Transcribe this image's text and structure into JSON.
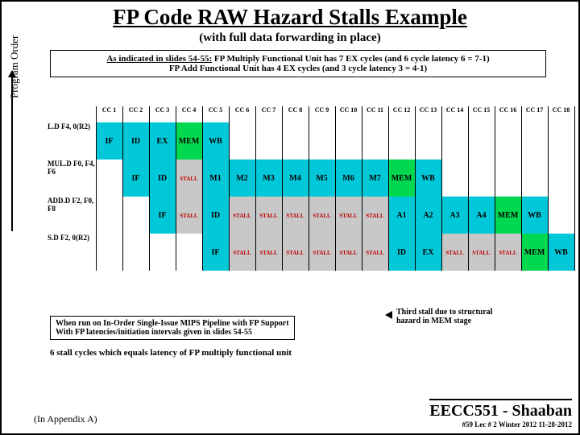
{
  "title": "FP Code RAW Hazard Stalls Example",
  "subtitle": "(with full data forwarding in place)",
  "note": {
    "lead": "As indicated in slides 54-55:",
    "line1": "FP Multiply Functional Unit has 7 EX cycles (and 6 cycle latency 6 = 7-1)",
    "line2": "FP Add Functional Unit has 4 EX cycles (and 3 cycle latency 3 = 4-1)"
  },
  "yaxis_label": "Program Order",
  "cycles": [
    "CC 1",
    "CC 2",
    "CC 3",
    "CC 4",
    "CC 5",
    "CC 6",
    "CC 7",
    "CC 8",
    "CC 9",
    "CC 10",
    "CC 11",
    "CC 12",
    "CC 13",
    "CC 14",
    "CC 15",
    "CC 16",
    "CC 17",
    "CC 18"
  ],
  "rows": [
    {
      "instr": "L.D F4, 0(R2)",
      "cells": [
        "IF",
        "ID",
        "EX",
        "MEM",
        "WB",
        "",
        "",
        "",
        "",
        "",
        "",
        "",
        "",
        "",
        "",
        "",
        "",
        ""
      ],
      "fill": [
        "c",
        "c",
        "c",
        "g",
        "c",
        "",
        "",
        "",
        "",
        "",
        "",
        "",
        "",
        "",
        "",
        "",
        "",
        ""
      ]
    },
    {
      "instr": "MUL.D F0, F4, F6",
      "cells": [
        "",
        "IF",
        "ID",
        "STALL",
        "M1",
        "M2",
        "M3",
        "M4",
        "M5",
        "M6",
        "M7",
        "MEM",
        "WB",
        "",
        "",
        "",
        "",
        ""
      ],
      "fill": [
        "",
        "c",
        "c",
        "x",
        "c",
        "c",
        "c",
        "c",
        "c",
        "c",
        "c",
        "g",
        "c",
        "",
        "",
        "",
        "",
        ""
      ]
    },
    {
      "instr": "ADD.D F2, F0, F8",
      "cells": [
        "",
        "",
        "IF",
        "STALL",
        "ID",
        "STALL",
        "STALL",
        "STALL",
        "STALL",
        "STALL",
        "STALL",
        "A1",
        "A2",
        "A3",
        "A4",
        "MEM",
        "WB",
        ""
      ],
      "fill": [
        "",
        "",
        "c",
        "x",
        "c",
        "x",
        "x",
        "x",
        "x",
        "x",
        "x",
        "c",
        "c",
        "c",
        "c",
        "g",
        "c",
        ""
      ]
    },
    {
      "instr": "S.D F2, 0(R2)",
      "cells": [
        "",
        "",
        "",
        "",
        "IF",
        "STALL",
        "STALL",
        "STALL",
        "STALL",
        "STALL",
        "STALL",
        "ID",
        "EX",
        "STALL",
        "STALL",
        "STALL",
        "MEM",
        "WB"
      ],
      "fill": [
        "",
        "",
        "",
        "",
        "c",
        "x",
        "x",
        "x",
        "x",
        "x",
        "x",
        "c",
        "c",
        "x",
        "x",
        "x",
        "g",
        "c"
      ]
    }
  ],
  "bottom_note1a": "When run on In-Order Single-Issue MIPS Pipeline with FP Support",
  "bottom_note1b": "With FP latencies/initiation intervals given in slides 54-55",
  "bottom_note2": "6 stall cycles which equals latency of FP multiply functional unit",
  "right_note": "Third stall due to structural hazard in MEM stage",
  "appendix": "(In  Appendix A)",
  "footer_course": "EECC551 - Shaaban",
  "footer_meta": "#59  Lec # 2  Winter 2012   11-28-2012"
}
